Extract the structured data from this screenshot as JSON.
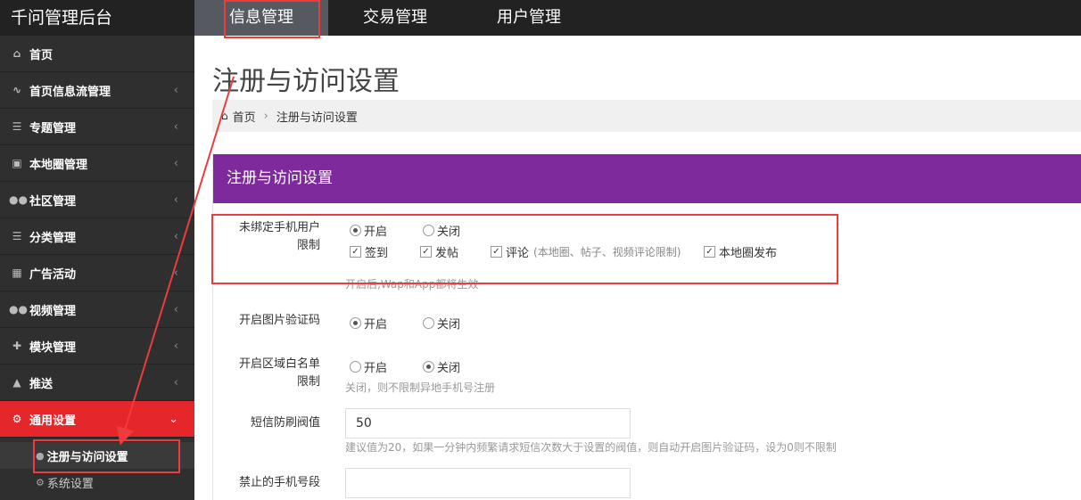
{
  "app": {
    "brand": "千问管理后台"
  },
  "topnav": [
    {
      "label": "信息管理",
      "active": true
    },
    {
      "label": "交易管理",
      "active": false
    },
    {
      "label": "用户管理",
      "active": false
    }
  ],
  "sidebar": {
    "items": [
      {
        "label": "首页",
        "icon": "home-icon"
      },
      {
        "label": "首页信息流管理",
        "icon": "rss-icon"
      },
      {
        "label": "专题管理",
        "icon": "list-icon"
      },
      {
        "label": "本地圈管理",
        "icon": "camera-icon"
      },
      {
        "label": "社区管理",
        "icon": "users-icon"
      },
      {
        "label": "分类管理",
        "icon": "list-icon"
      },
      {
        "label": "广告活动",
        "icon": "calendar-icon"
      },
      {
        "label": "视频管理",
        "icon": "users-icon"
      },
      {
        "label": "模块管理",
        "icon": "puzzle-icon"
      },
      {
        "label": "推送",
        "icon": "bell-icon"
      },
      {
        "label": "通用设置",
        "icon": "cogs-icon",
        "active": true
      }
    ],
    "sub_items": [
      {
        "label": "注册与访问设置",
        "icon": "user-icon",
        "active": true
      },
      {
        "label": "系统设置",
        "icon": "cogs-icon"
      }
    ]
  },
  "page": {
    "title": "注册与访问设置"
  },
  "breadcrumb": {
    "home": "首页",
    "current": "注册与访问设置"
  },
  "panel": {
    "title": "注册与访问设置"
  },
  "form": {
    "unbound_phone": {
      "label_line1": "未绑定手机用户",
      "label_line2": "限制",
      "radio_on": "开启",
      "radio_off": "关闭",
      "selected": "开启",
      "checks": {
        "signin": "签到",
        "post": "发帖",
        "comment": "评论",
        "comment_note": "(本地圈、帖子、视频评论限制)",
        "local_post": "本地圈发布"
      },
      "hint": "开启后,Wap和App都将生效"
    },
    "captcha": {
      "label": "开启图片验证码",
      "radio_on": "开启",
      "radio_off": "关闭",
      "selected": "开启"
    },
    "whitelist": {
      "label_line1": "开启区域白名单",
      "label_line2": "限制",
      "radio_on": "开启",
      "radio_off": "关闭",
      "selected": "关闭",
      "hint": "关闭，则不限制异地手机号注册"
    },
    "sms_threshold": {
      "label": "短信防刷阀值",
      "value": "50",
      "hint": "建议值为20，如果一分钟内频繁请求短信次数大于设置的阀值，则自动开启图片验证码，设为0则不限制"
    },
    "banned_prefix": {
      "label": "禁止的手机号段",
      "value": ""
    }
  },
  "colors": {
    "topbar": "#222222",
    "sidebar": "#2f2f2f",
    "active_red": "#e5262a",
    "panel_head": "#7f2a9c",
    "annotation": "#ee3b3b"
  }
}
